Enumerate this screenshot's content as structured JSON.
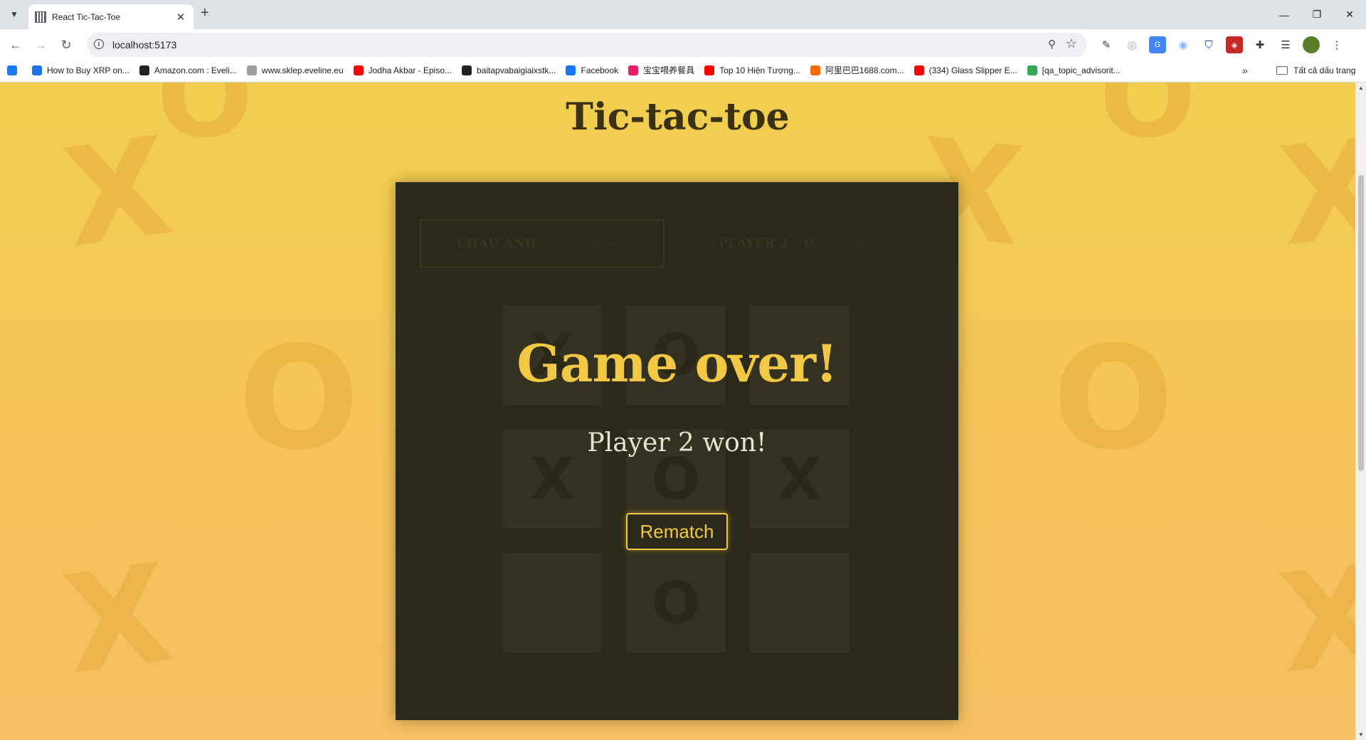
{
  "browser": {
    "tab_title": "React Tic-Tac-Toe",
    "url": "localhost:5173",
    "bookmarks": [
      {
        "label": "",
        "color": "#1877f2"
      },
      {
        "label": "How to Buy XRP on...",
        "color": "#1a73e8"
      },
      {
        "label": "Amazon.com : Eveli...",
        "color": "#222222"
      },
      {
        "label": "www.sklep.eveline.eu",
        "color": "#9e9e9e"
      },
      {
        "label": "Jodha Akbar - Episo...",
        "color": "#ff0000"
      },
      {
        "label": "baitapvabaigiaixstk...",
        "color": "#202124"
      },
      {
        "label": "Facebook",
        "color": "#1877f2"
      },
      {
        "label": "宝宝喂养餐具",
        "color": "#e91e63"
      },
      {
        "label": "Top 10 Hiện Tượng...",
        "color": "#ff0000"
      },
      {
        "label": "阿里巴巴1688.com...",
        "color": "#ff6a00"
      },
      {
        "label": "(334) Glass Slipper E...",
        "color": "#ff0000"
      },
      {
        "label": "[qa_topic_advisorit...",
        "color": "#34a853"
      }
    ],
    "all_bookmarks_label": "Tất cả dấu trang"
  },
  "page": {
    "title": "Tic-tac-toe"
  },
  "players": [
    {
      "name": "CHAU ANH",
      "symbol": "X",
      "action": "Save"
    },
    {
      "name": "PLAYER 2",
      "symbol": "O",
      "action": "Edit"
    }
  ],
  "board": [
    [
      "X",
      "O",
      ""
    ],
    [
      "X",
      "O",
      "X"
    ],
    [
      "",
      "O",
      ""
    ]
  ],
  "game_over": {
    "title": "Game over!",
    "message": "Player 2 won!",
    "rematch_label": "Rematch"
  },
  "colors": {
    "background": "#f2cf4e",
    "panel": "#2b2919",
    "accent": "#f2c744",
    "title_text": "#3b3110"
  }
}
